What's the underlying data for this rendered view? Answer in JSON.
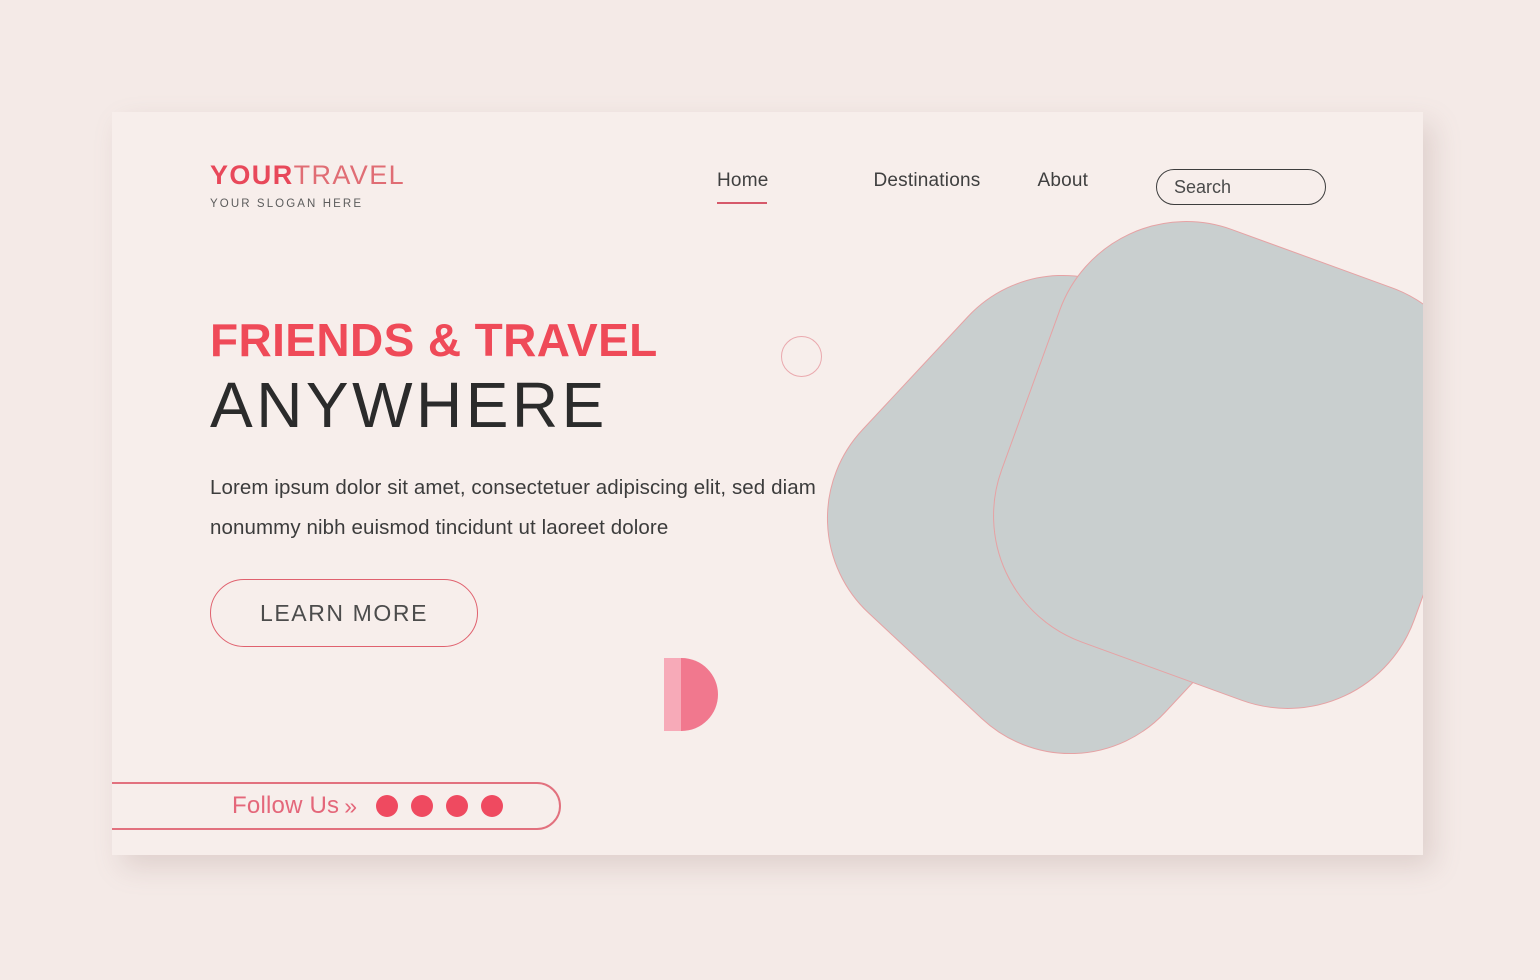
{
  "brand": {
    "name_bold": "YOUR",
    "name_light": "TRAVEL",
    "slogan": "YOUR SLOGAN HERE"
  },
  "nav": {
    "items": [
      {
        "label": "Home",
        "active": true
      },
      {
        "label": "Destinations",
        "active": false
      },
      {
        "label": "About",
        "active": false
      }
    ]
  },
  "search": {
    "placeholder": "Search",
    "value": ""
  },
  "hero": {
    "headline_top": "FRIENDS & TRAVEL",
    "headline_bottom": "ANYWHERE",
    "paragraph": "Lorem ipsum dolor sit amet, consectetuer adipiscing elit, sed diam nonummy nibh euismod tincidunt ut laoreet dolore",
    "cta_label": "LEARN MORE"
  },
  "follow": {
    "label": "Follow Us",
    "chevron": "»",
    "social_dots": [
      {
        "name": "social-dot-1"
      },
      {
        "name": "social-dot-2"
      },
      {
        "name": "social-dot-3"
      },
      {
        "name": "social-dot-4"
      }
    ]
  },
  "colors": {
    "page_background": "#f4eae7",
    "card_background": "#f7eeeb",
    "accent_red": "#ef4a58",
    "accent_pink": "#e4677a",
    "outline_pink": "#e6a2a4",
    "shape_gray": "#c9cfcf",
    "text_dark": "#2b2b2b"
  }
}
